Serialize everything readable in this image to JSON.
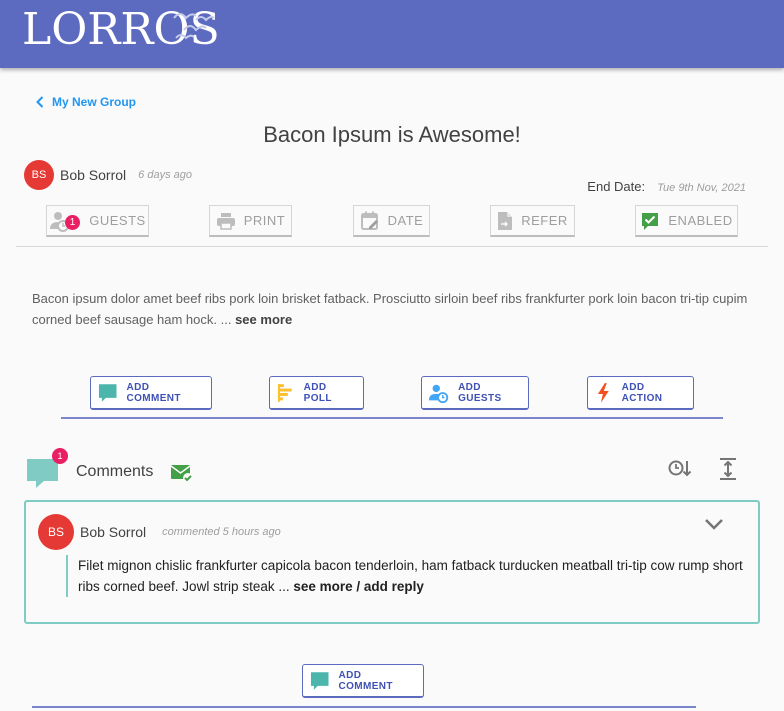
{
  "brand": {
    "logo_text": "LORROS",
    "bar_color": "#5c6bc0"
  },
  "nav": {
    "back_label": "My New Group",
    "back_icon": "chevron-left-icon"
  },
  "post": {
    "title": "Bacon Ipsum is Awesome!",
    "author_initials": "BS",
    "author_name": "Bob Sorrol",
    "time": "6 days ago",
    "end_date_label": "End Date:",
    "end_date_value": "Tue 9th Nov, 2021",
    "body": "Bacon ipsum dolor amet beef ribs pork loin brisket fatback. Prosciutto sirloin beef ribs frankfurter pork loin bacon tri-tip cupim corned beef sausage ham hock. ... ",
    "see_more": "see more"
  },
  "toolbar": {
    "guests": {
      "label": "GUESTS",
      "badge": "1",
      "icon": "guests-clock-icon"
    },
    "print": {
      "label": "PRINT",
      "icon": "printer-icon"
    },
    "date": {
      "label": "DATE",
      "icon": "calendar-edit-icon"
    },
    "refer": {
      "label": "REFER",
      "icon": "file-share-icon"
    },
    "enabled": {
      "label": "ENABLED",
      "icon": "check-box-icon"
    }
  },
  "actions": {
    "add_comment": "ADD COMMENT",
    "add_poll": "ADD POLL",
    "add_guests": "ADD GUESTS",
    "add_action": "ADD ACTION"
  },
  "comments": {
    "title": "Comments",
    "badge": "1",
    "items": [
      {
        "initials": "BS",
        "name": "Bob Sorrol",
        "time": "commented 5 hours ago",
        "text": "Filet mignon chislic frankfurter capicola bacon tenderloin, ham fatback turducken meatball tri-tip cow rump short ribs corned beef. Jowl strip steak ... ",
        "link": "see more / add reply"
      }
    ],
    "add_comment": "ADD COMMENT"
  },
  "colors": {
    "accent": "#3f51b5",
    "teal": "#80cbc4",
    "avatar": "#e53935",
    "badge": "#e91e63",
    "enabled_green": "#43a047",
    "action_orange": "#f4511e",
    "poll_yellow": "#fbc02d",
    "guest_blue": "#42a5f5"
  }
}
